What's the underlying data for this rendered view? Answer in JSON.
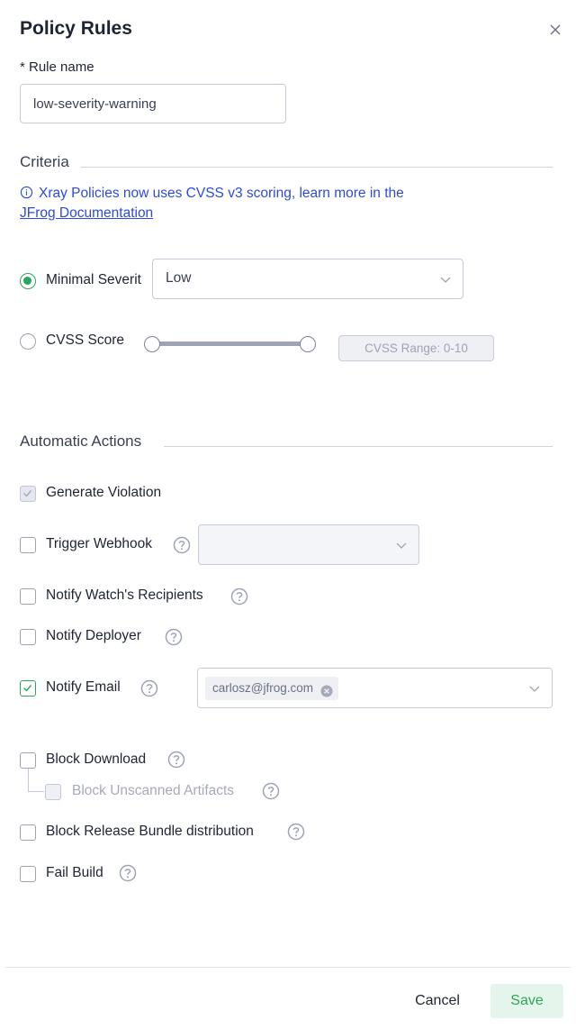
{
  "dialog": {
    "title": "Policy Rules",
    "close_icon": "close-icon"
  },
  "rule_name": {
    "label": "* Rule name",
    "value": "low-severity-warning"
  },
  "criteria": {
    "section_title": "Criteria",
    "info_text": "Xray Policies now uses CVSS v3 scoring, learn more in the ",
    "info_link": "JFrog Documentation",
    "minimal_severity": {
      "label": "Minimal Severit",
      "selected": true,
      "value": "Low"
    },
    "cvss_score": {
      "label": "CVSS Score",
      "selected": false,
      "range_placeholder": "CVSS Range: 0-10"
    }
  },
  "automatic_actions": {
    "section_title": "Automatic Actions",
    "generate_violation": {
      "label": "Generate Violation",
      "checked": true,
      "disabled": true
    },
    "trigger_webhook": {
      "label": "Trigger Webhook",
      "checked": false,
      "value": ""
    },
    "notify_watch_recipients": {
      "label": "Notify Watch's Recipients",
      "checked": false
    },
    "notify_deployer": {
      "label": "Notify Deployer",
      "checked": false
    },
    "notify_email": {
      "label": "Notify Email",
      "checked": true,
      "chips": [
        "carlosz@jfrog.com"
      ]
    },
    "block_download": {
      "label": "Block Download",
      "checked": false
    },
    "block_unscanned": {
      "label": "Block Unscanned Artifacts",
      "checked": false,
      "disabled": true
    },
    "block_release_bundle": {
      "label": "Block Release Bundle distribution",
      "checked": false
    },
    "fail_build": {
      "label": "Fail Build",
      "checked": false
    }
  },
  "footer": {
    "cancel_label": "Cancel",
    "save_label": "Save"
  },
  "colors": {
    "accent_green": "#2aa65a",
    "link_blue": "#2d4bd6",
    "border": "#c8cbd9"
  }
}
